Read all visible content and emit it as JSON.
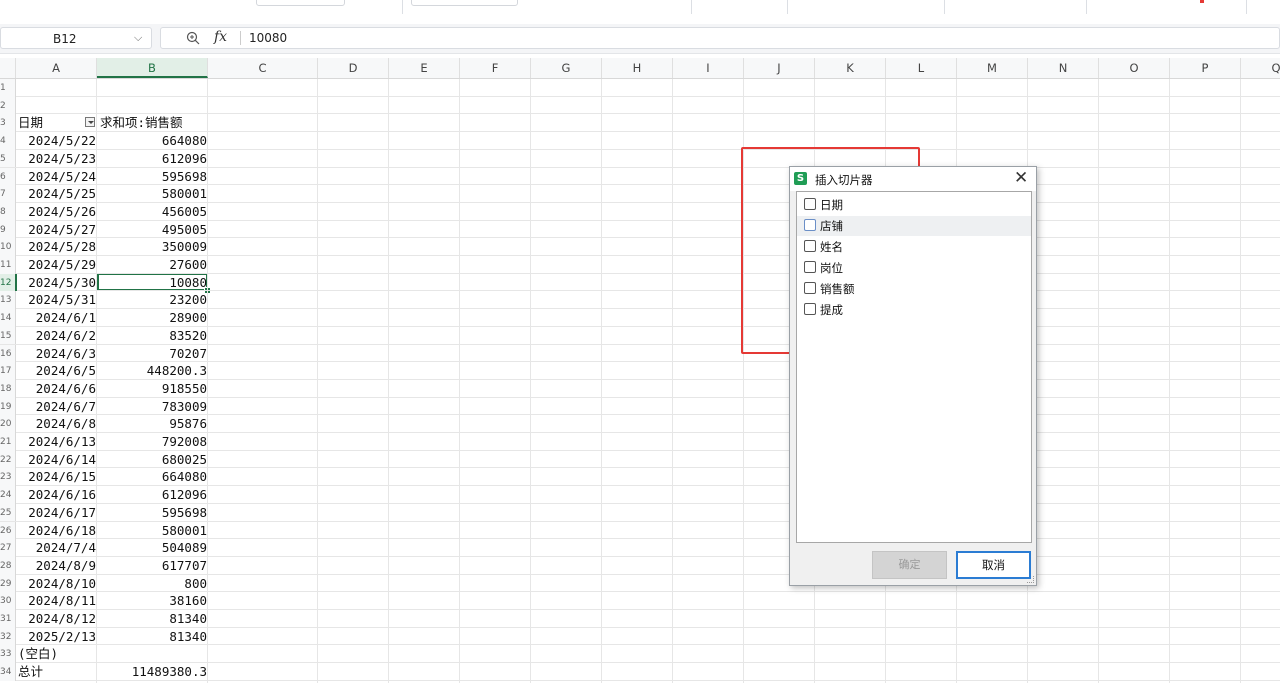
{
  "name_box": {
    "value": "B12"
  },
  "formula_bar": {
    "fx_label": "fx",
    "value": "10080"
  },
  "columns": [
    "A",
    "B",
    "C",
    "D",
    "E",
    "F",
    "G",
    "H",
    "I",
    "J",
    "K",
    "L",
    "M",
    "N",
    "O",
    "P",
    "Q"
  ],
  "selected_column": "B",
  "row_numbers": [
    "1",
    "2",
    "3",
    "4",
    "5",
    "6",
    "7",
    "8",
    "9",
    "10",
    "11",
    "12",
    "13",
    "14",
    "15",
    "16",
    "17",
    "18",
    "19",
    "20",
    "21",
    "22",
    "23",
    "24",
    "25",
    "26",
    "27",
    "28",
    "29",
    "30",
    "31",
    "32",
    "33",
    "34"
  ],
  "selected_row": "12",
  "pivot": {
    "header_a": "日期",
    "header_b": "求和项:销售额",
    "rows": [
      {
        "a": "2024/5/22",
        "b": "664080"
      },
      {
        "a": "2024/5/23",
        "b": "612096"
      },
      {
        "a": "2024/5/24",
        "b": "595698"
      },
      {
        "a": "2024/5/25",
        "b": "580001"
      },
      {
        "a": "2024/5/26",
        "b": "456005"
      },
      {
        "a": "2024/5/27",
        "b": "495005"
      },
      {
        "a": "2024/5/28",
        "b": "350009"
      },
      {
        "a": "2024/5/29",
        "b": "27600"
      },
      {
        "a": "2024/5/30",
        "b": "10080"
      },
      {
        "a": "2024/5/31",
        "b": "23200"
      },
      {
        "a": "2024/6/1",
        "b": "28900"
      },
      {
        "a": "2024/6/2",
        "b": "83520"
      },
      {
        "a": "2024/6/3",
        "b": "70207"
      },
      {
        "a": "2024/6/5",
        "b": "448200.3"
      },
      {
        "a": "2024/6/6",
        "b": "918550"
      },
      {
        "a": "2024/6/7",
        "b": "783009"
      },
      {
        "a": "2024/6/8",
        "b": "95876"
      },
      {
        "a": "2024/6/13",
        "b": "792008"
      },
      {
        "a": "2024/6/14",
        "b": "680025"
      },
      {
        "a": "2024/6/15",
        "b": "664080"
      },
      {
        "a": "2024/6/16",
        "b": "612096"
      },
      {
        "a": "2024/6/17",
        "b": "595698"
      },
      {
        "a": "2024/6/18",
        "b": "580001"
      },
      {
        "a": "2024/7/4",
        "b": "504089"
      },
      {
        "a": "2024/8/9",
        "b": "617707"
      },
      {
        "a": "2024/8/10",
        "b": "800"
      },
      {
        "a": "2024/8/11",
        "b": "38160"
      },
      {
        "a": "2024/8/12",
        "b": "81340"
      },
      {
        "a": "2025/2/13",
        "b": "81340"
      },
      {
        "a": "(空白)",
        "b": ""
      }
    ],
    "total_label": "总计",
    "total_value": "11489380.3"
  },
  "dialog": {
    "logo": "S",
    "title": "插入切片器",
    "close_glyph": "✕",
    "items": [
      "日期",
      "店铺",
      "姓名",
      "岗位",
      "销售额",
      "提成"
    ],
    "highlighted_index": 1,
    "ok_label": "确定",
    "cancel_label": "取消"
  },
  "colors": {
    "accent": "#217346",
    "annotation": "#e53935",
    "dialog_focus": "#2b7cd3"
  }
}
